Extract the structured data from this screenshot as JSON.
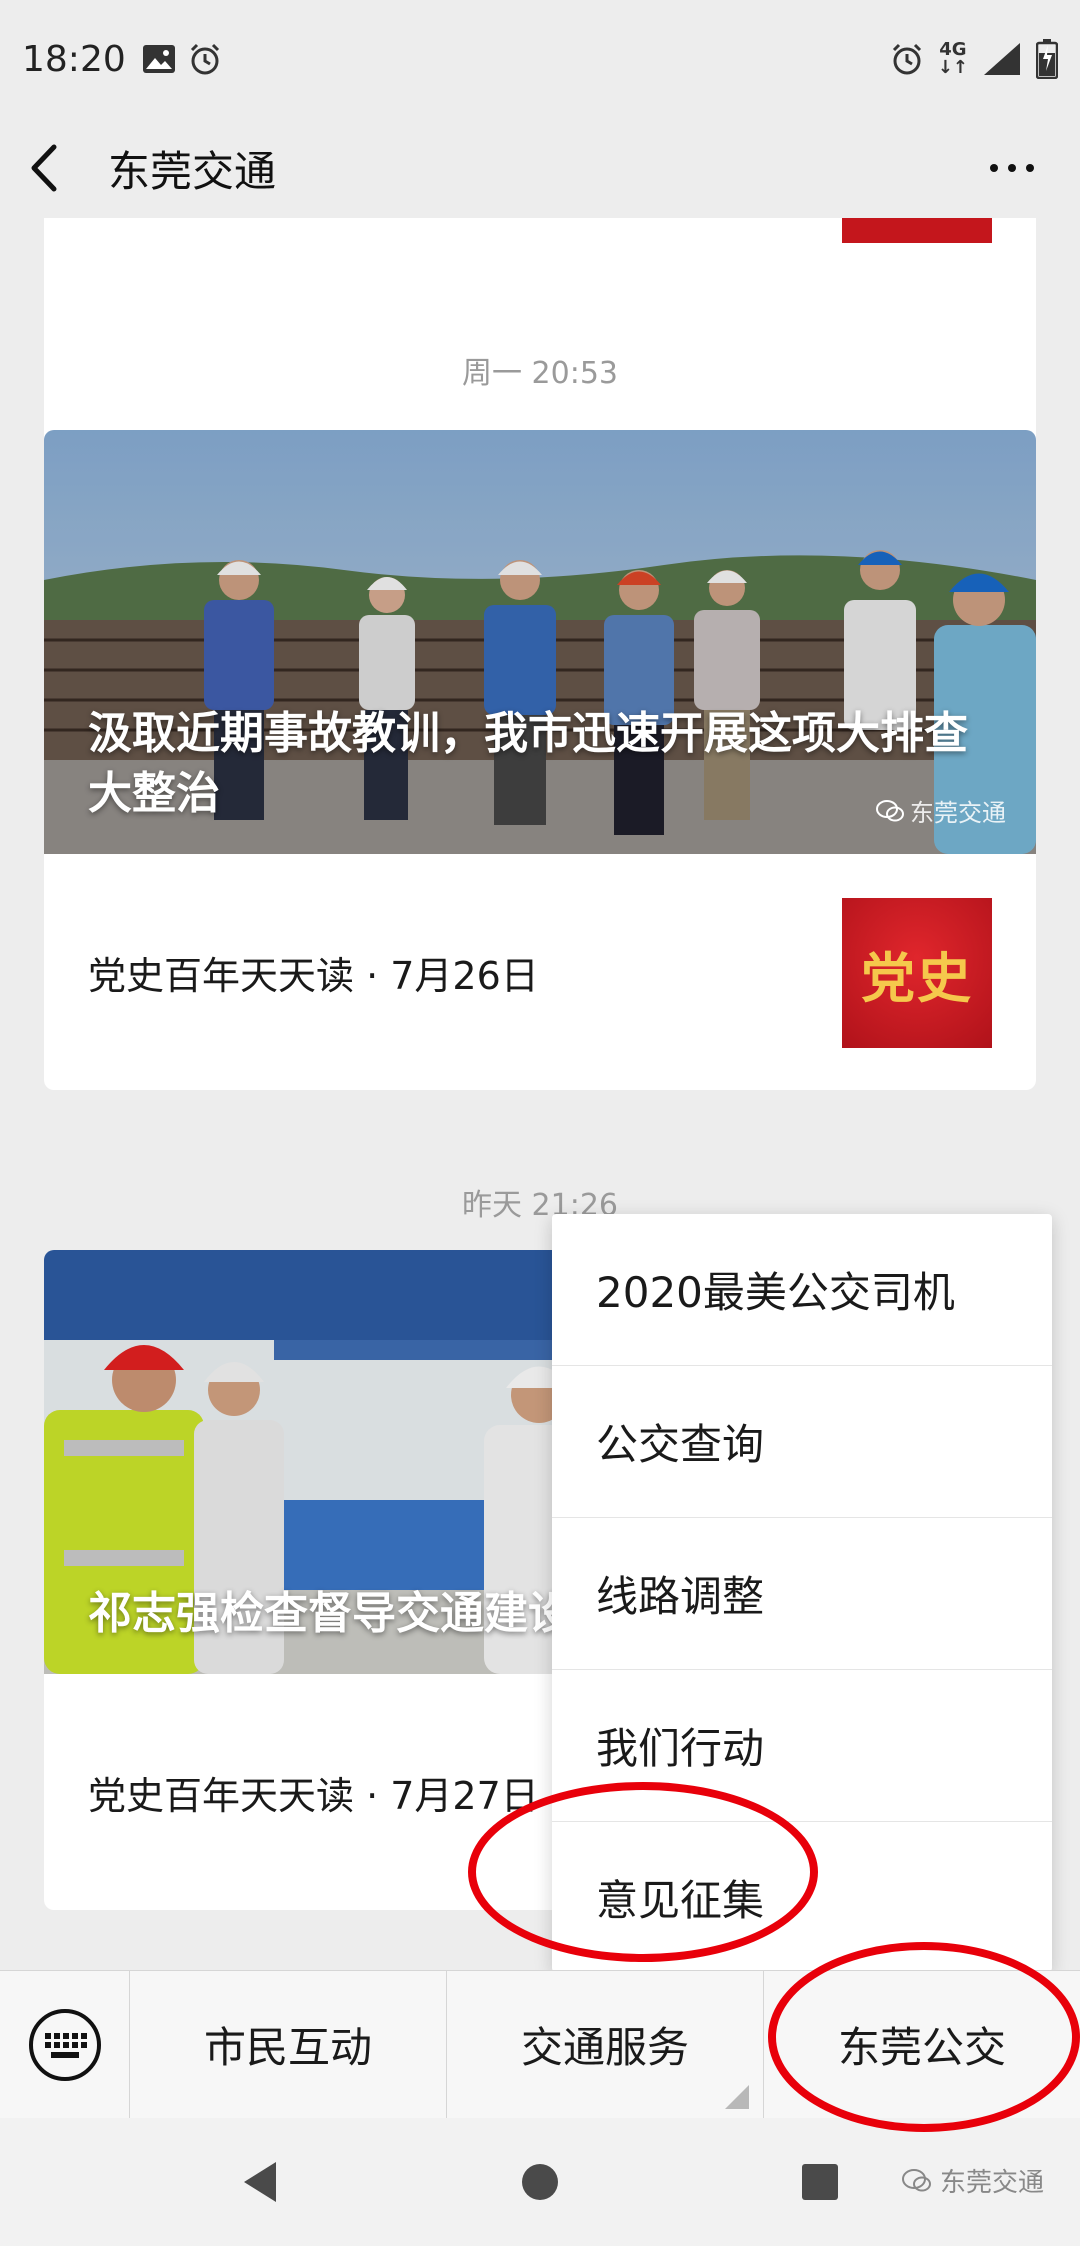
{
  "status_bar": {
    "time": "18:20",
    "network": "4G"
  },
  "header": {
    "title": "东莞交通"
  },
  "feed": {
    "items": [
      {
        "timestamp": "周一 20:53",
        "hero_title": "汲取近期事故教训，我市迅速开展这项大排查大整治",
        "watermark": "东莞交通",
        "sub_title": "党史百年天天读 · 7月26日",
        "sub_thumb_text": "党史"
      },
      {
        "timestamp": "昨天 21:26",
        "hero_title": "祁志强检查督导交通建设",
        "sub_title": "党史百年天天读 · 7月27日"
      }
    ]
  },
  "popup_menu": {
    "items": [
      "2020最美公交司机",
      "公交查询",
      "线路调整",
      "我们行动",
      "意见征集"
    ]
  },
  "bottom_menu": {
    "tabs": [
      "市民互动",
      "交通服务",
      "东莞公交"
    ]
  },
  "nav_bar": {
    "watermark": "东莞交通"
  },
  "colors": {
    "accent_red": "#e8000a",
    "thumb_red": "#c4161c",
    "background": "#ededed"
  }
}
